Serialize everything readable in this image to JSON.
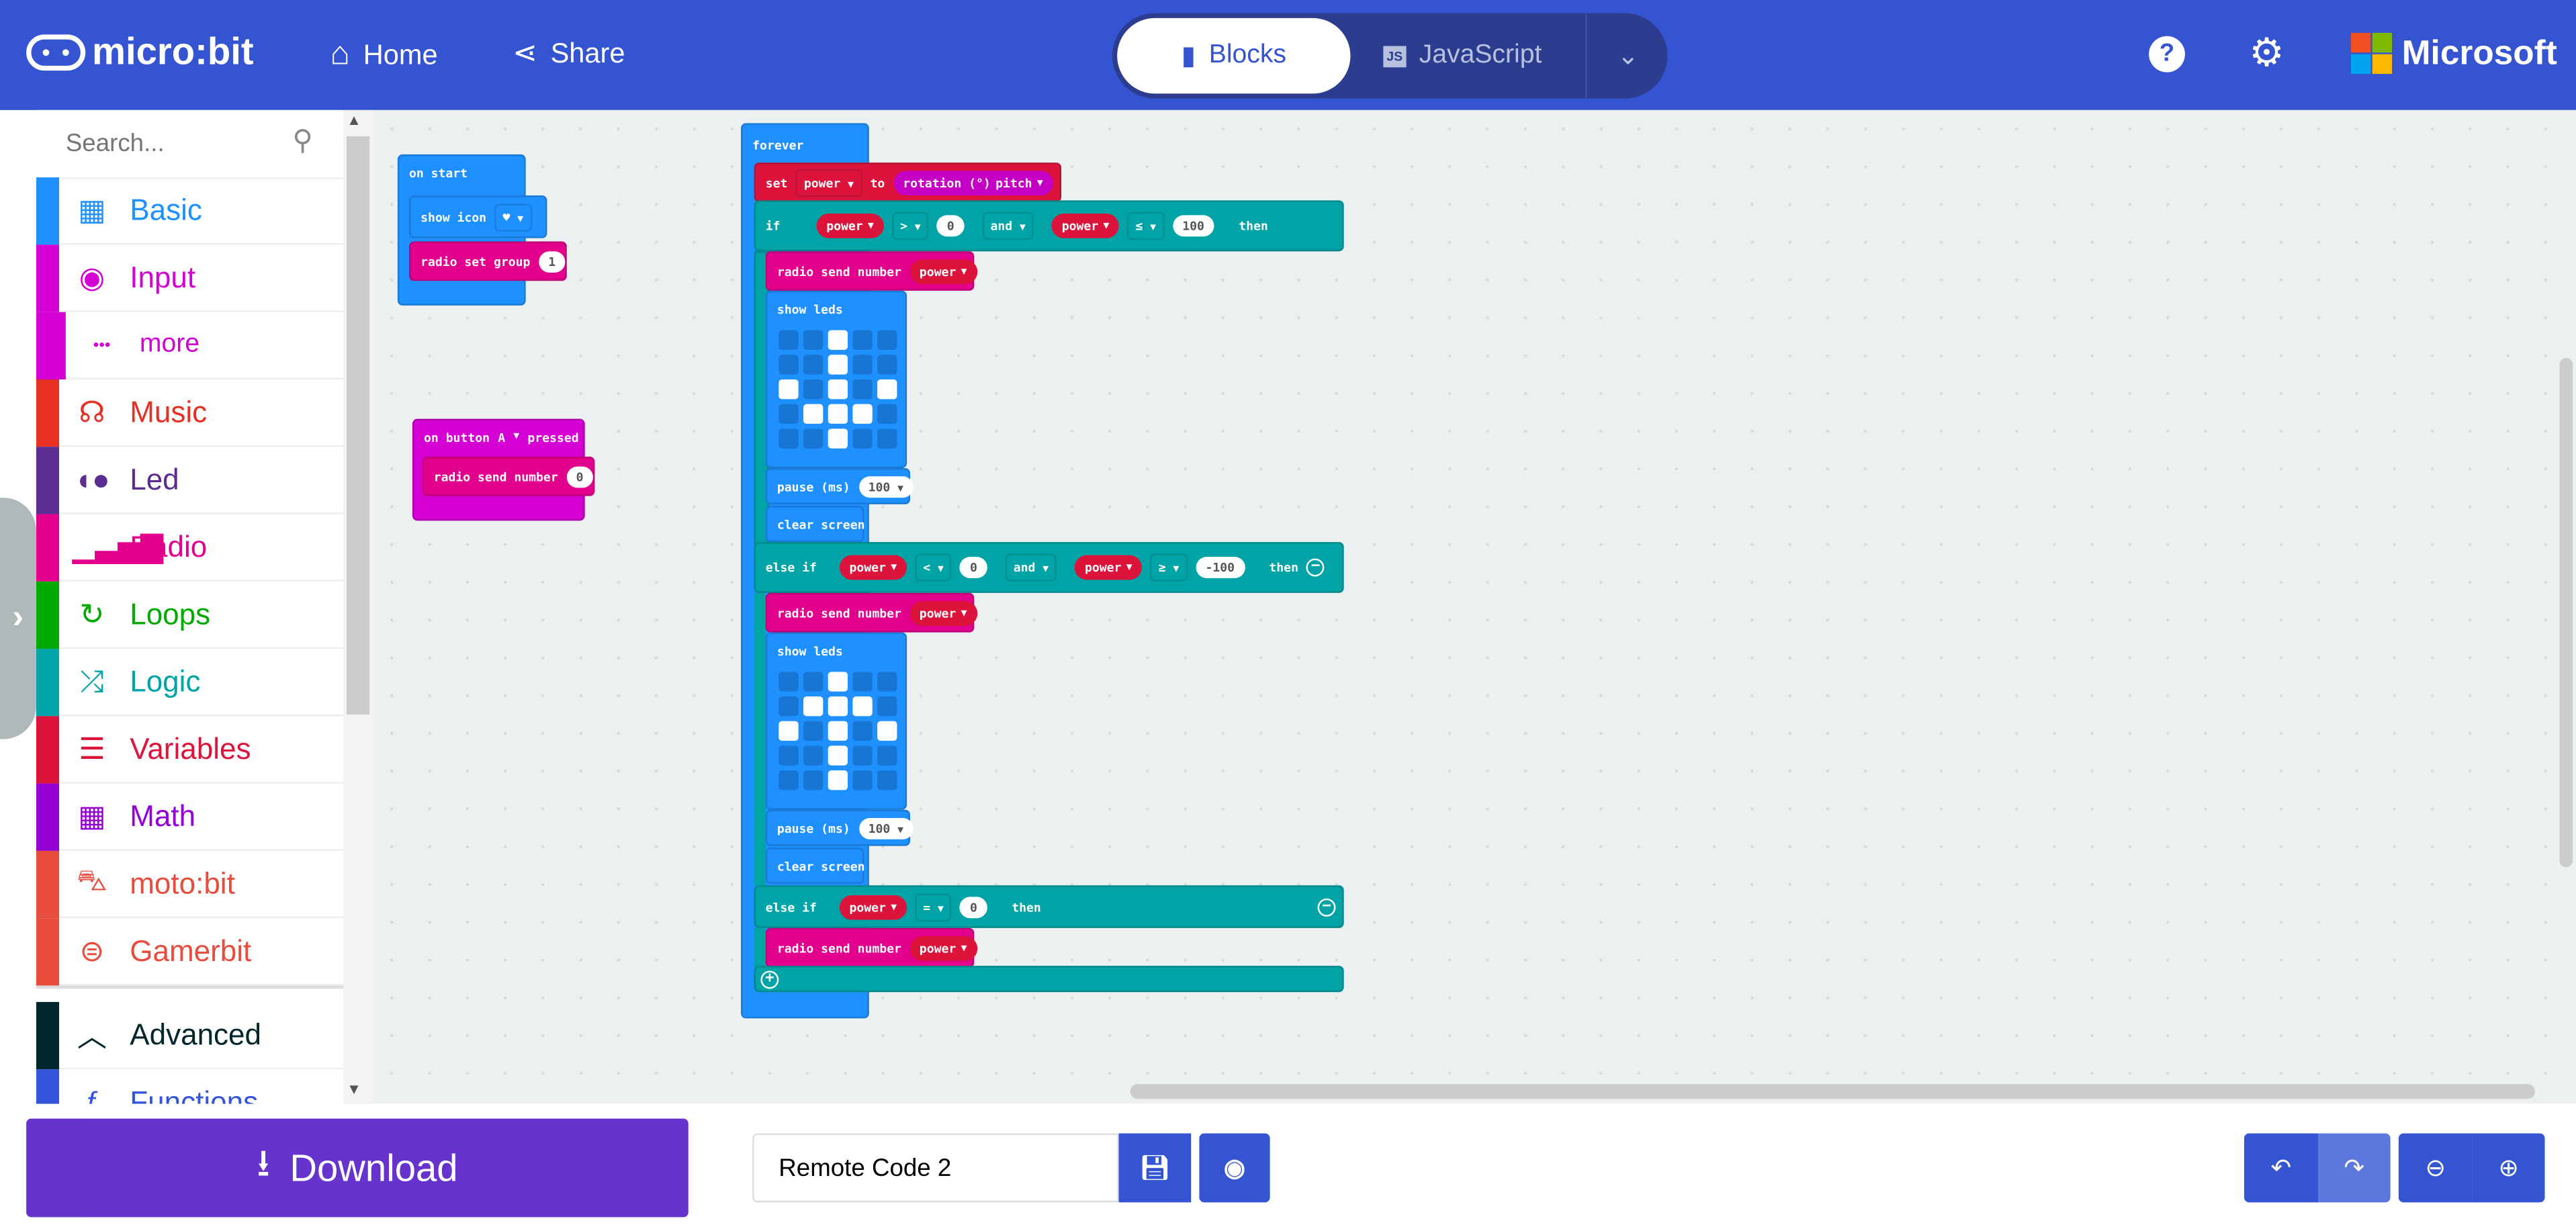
{
  "header": {
    "brand": "micro:bit",
    "home_label": "Home",
    "share_label": "Share",
    "tabs": [
      {
        "label": "Blocks",
        "active": true
      },
      {
        "label": "JavaScript",
        "active": false
      }
    ],
    "microsoft_label": "Microsoft",
    "colors": {
      "bar": "#3454D1"
    }
  },
  "sidebar": {
    "search_placeholder": "Search...",
    "categories": [
      {
        "label": "Basic",
        "icon": "grid-icon",
        "color": "#1E90FF"
      },
      {
        "label": "Input",
        "icon": "target-icon",
        "color": "#D400D4"
      },
      {
        "label": "more",
        "icon": "ellipsis-icon",
        "color": "#D400D4"
      },
      {
        "label": "Music",
        "icon": "headphones-icon",
        "color": "#E63022"
      },
      {
        "label": "Led",
        "icon": "toggle-icon",
        "color": "#5C2D91"
      },
      {
        "label": "Radio",
        "icon": "signal-bars-icon",
        "color": "#E3008C"
      },
      {
        "label": "Loops",
        "icon": "refresh-icon",
        "color": "#00AA00"
      },
      {
        "label": "Logic",
        "icon": "shuffle-icon",
        "color": "#00A4A6"
      },
      {
        "label": "Variables",
        "icon": "list-icon",
        "color": "#DC143C"
      },
      {
        "label": "Math",
        "icon": "calculator-icon",
        "color": "#9400D3"
      },
      {
        "label": "moto:bit",
        "icon": "car-icon",
        "color": "#E74C3C"
      },
      {
        "label": "Gamerbit",
        "icon": "gamepad-icon",
        "color": "#E74C3C"
      },
      {
        "label": "Advanced",
        "icon": "chevron-up-icon",
        "color": "#00272B"
      },
      {
        "label": "Functions",
        "icon": "function-icon",
        "color": "#3455DB"
      }
    ]
  },
  "workspace": {
    "on_start": {
      "label": "on start",
      "show_icon": "show icon",
      "radio_set_group": "radio set group",
      "group_value": "1"
    },
    "on_button": {
      "prefix": "on button",
      "button": "A",
      "suffix": "pressed",
      "send": "radio send number",
      "send_value": "0"
    },
    "forever": {
      "label": "forever",
      "set": {
        "set": "set",
        "var": "power",
        "to": "to",
        "sensor": "rotation (°)",
        "axis": "pitch"
      },
      "if1": {
        "kw": "if",
        "var1": "power",
        "op1": ">",
        "val1": "0",
        "and": "and",
        "var2": "power",
        "op2": "≤",
        "val2": "100",
        "then": "then"
      },
      "send": "radio send number",
      "send_var": "power",
      "show_leds": "show leds",
      "leds1": [
        [
          0,
          0,
          1,
          0,
          0
        ],
        [
          0,
          0,
          1,
          0,
          0
        ],
        [
          1,
          0,
          1,
          0,
          1
        ],
        [
          0,
          1,
          1,
          1,
          0
        ],
        [
          0,
          0,
          1,
          0,
          0
        ]
      ],
      "pause": "pause (ms)",
      "pause_value": "100",
      "clear": "clear screen",
      "if2": {
        "kw": "else if",
        "var1": "power",
        "op1": "<",
        "val1": "0",
        "and": "and",
        "var2": "power",
        "op2": "≥",
        "val2": "-100",
        "then": "then"
      },
      "leds2": [
        [
          0,
          0,
          1,
          0,
          0
        ],
        [
          0,
          1,
          1,
          1,
          0
        ],
        [
          1,
          0,
          1,
          0,
          1
        ],
        [
          0,
          0,
          1,
          0,
          0
        ],
        [
          0,
          0,
          1,
          0,
          0
        ]
      ],
      "if3": {
        "kw": "else if",
        "var1": "power",
        "op1": "=",
        "val1": "0",
        "then": "then"
      }
    }
  },
  "footer": {
    "download_label": "Download",
    "project_name": "Remote Code 2"
  }
}
